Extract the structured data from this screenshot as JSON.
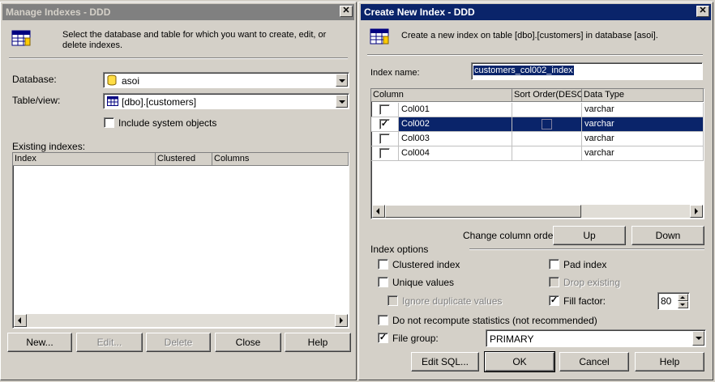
{
  "manage": {
    "title": "Manage Indexes - DDD",
    "description": "Select the database and table for which you want to create, edit, or delete indexes.",
    "database_label": "Database:",
    "database_value": "asoi",
    "table_label": "Table/view:",
    "table_value": "[dbo].[customers]",
    "include_system_label": "Include system objects",
    "existing_label": "Existing indexes:",
    "columns": [
      "Index",
      "Clustered",
      "Columns"
    ],
    "buttons": {
      "new": "New...",
      "edit": "Edit...",
      "delete": "Delete",
      "close": "Close",
      "help": "Help"
    }
  },
  "create": {
    "title": "Create New Index - DDD",
    "description": "Create a new index on table [dbo].[customers] in database [asoi].",
    "index_name_label": "Index name:",
    "index_name_value": "customers_col002_index",
    "grid_headers": [
      "Column",
      "Sort Order(DESC)",
      "Data Type"
    ],
    "rows": [
      {
        "name": "Col001",
        "type": "varchar",
        "checked": false
      },
      {
        "name": "Col002",
        "type": "varchar",
        "checked": true
      },
      {
        "name": "Col003",
        "type": "varchar",
        "checked": false
      },
      {
        "name": "Col004",
        "type": "varchar",
        "checked": false
      }
    ],
    "change_order_label": "Change column order:",
    "up": "Up",
    "down": "Down",
    "index_options_label": "Index options",
    "clustered_label": "Clustered index",
    "pad_label": "Pad index",
    "unique_label": "Unique values",
    "drop_label": "Drop existing",
    "ignore_dup_label": "Ignore duplicate values",
    "fill_factor_label": "Fill factor:",
    "fill_factor_value": "80",
    "no_recompute_label": "Do not recompute statistics (not recommended)",
    "file_group_label": "File group:",
    "file_group_value": "PRIMARY",
    "buttons": {
      "edit_sql": "Edit SQL...",
      "ok": "OK",
      "cancel": "Cancel",
      "help": "Help"
    }
  },
  "check_mark": "✓",
  "close_glyph": "✕"
}
